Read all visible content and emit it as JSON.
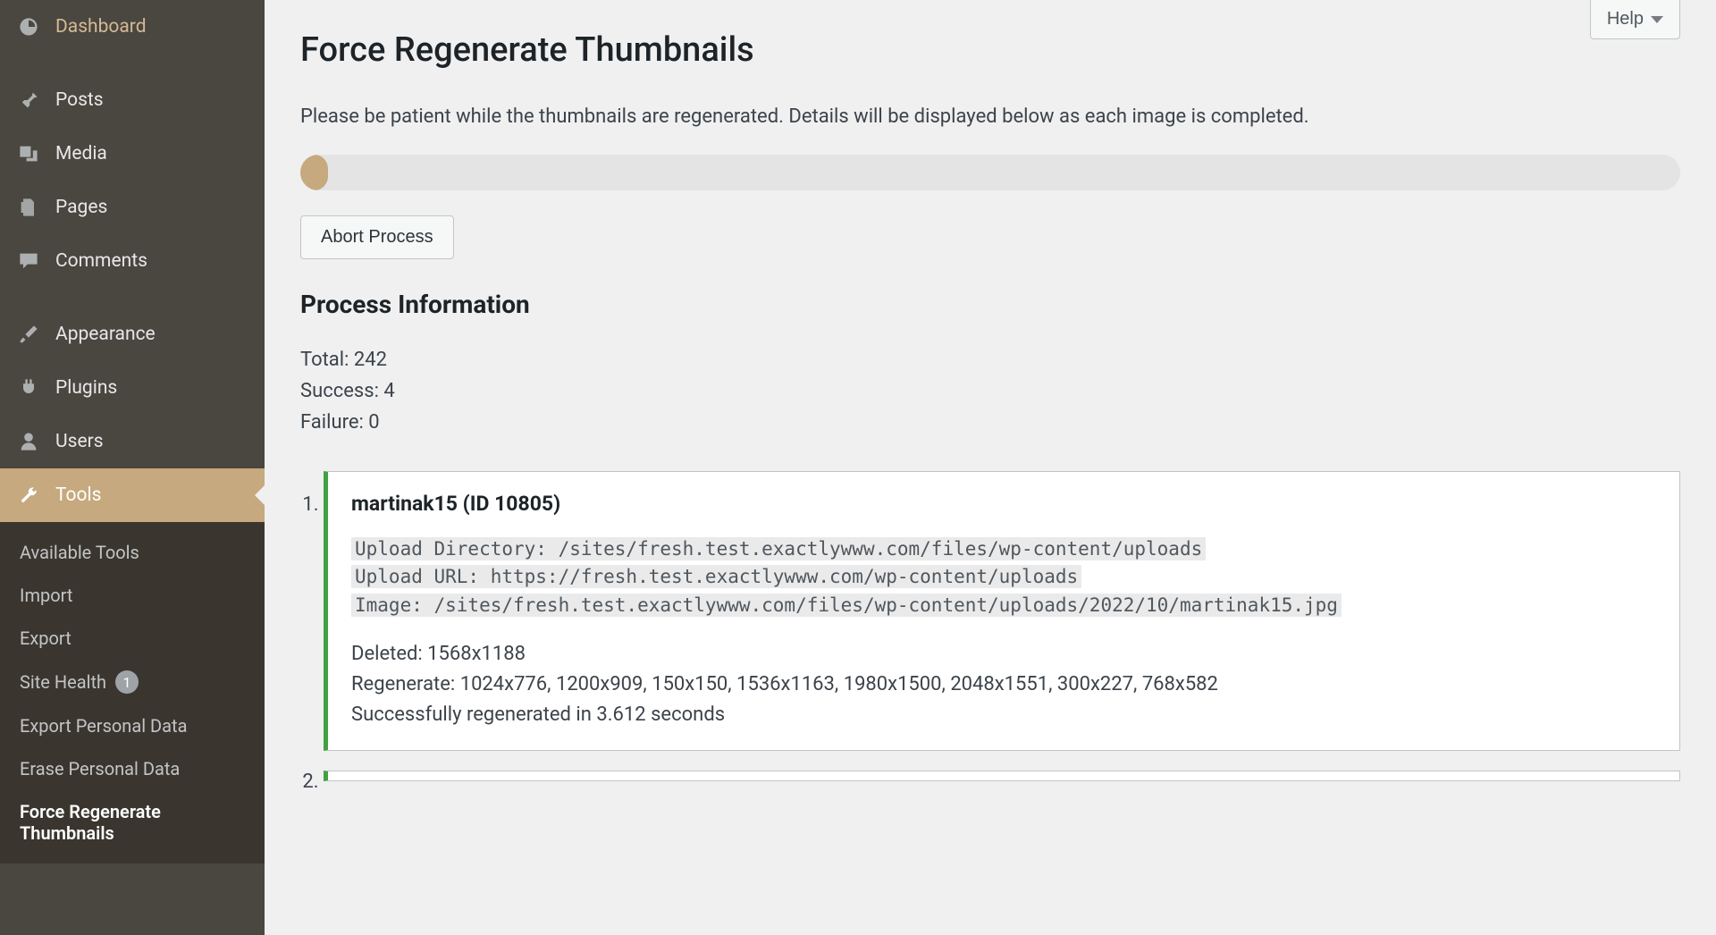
{
  "sidebar": {
    "items": [
      {
        "label": "Dashboard",
        "icon": "dashboard"
      },
      {
        "label": "Posts",
        "icon": "pin"
      },
      {
        "label": "Media",
        "icon": "media"
      },
      {
        "label": "Pages",
        "icon": "pages"
      },
      {
        "label": "Comments",
        "icon": "comment"
      },
      {
        "label": "Appearance",
        "icon": "brush"
      },
      {
        "label": "Plugins",
        "icon": "plug"
      },
      {
        "label": "Users",
        "icon": "user"
      },
      {
        "label": "Tools",
        "icon": "wrench",
        "active": true
      }
    ],
    "submenu": [
      {
        "label": "Available Tools"
      },
      {
        "label": "Import"
      },
      {
        "label": "Export"
      },
      {
        "label": "Site Health",
        "badge": "1"
      },
      {
        "label": "Export Personal Data"
      },
      {
        "label": "Erase Personal Data"
      },
      {
        "label": "Force Regenerate Thumbnails",
        "current": true
      }
    ]
  },
  "help_label": "Help",
  "page_title": "Force Regenerate Thumbnails",
  "intro_text": "Please be patient while the thumbnails are regenerated. Details will be displayed below as each image is completed.",
  "abort_label": "Abort Process",
  "process_heading": "Process Information",
  "stats": {
    "total_label": "Total: ",
    "total_value": "242",
    "success_label": "Success: ",
    "success_value": "4",
    "failure_label": "Failure: ",
    "failure_value": "0"
  },
  "results": {
    "item1": {
      "title": "martinak15 (ID 10805)",
      "upload_dir": "Upload Directory: /sites/fresh.test.exactlywww.com/files/wp-content/uploads",
      "upload_url": "Upload URL: https://fresh.test.exactlywww.com/wp-content/uploads",
      "image_path": "Image: /sites/fresh.test.exactlywww.com/files/wp-content/uploads/2022/10/martinak15.jpg",
      "deleted": "Deleted: 1568x1188",
      "regenerate": "Regenerate: 1024x776, 1200x909, 150x150, 1536x1163, 1980x1500, 2048x1551, 300x227, 768x582",
      "success_msg": "Successfully regenerated in 3.612 seconds"
    }
  }
}
